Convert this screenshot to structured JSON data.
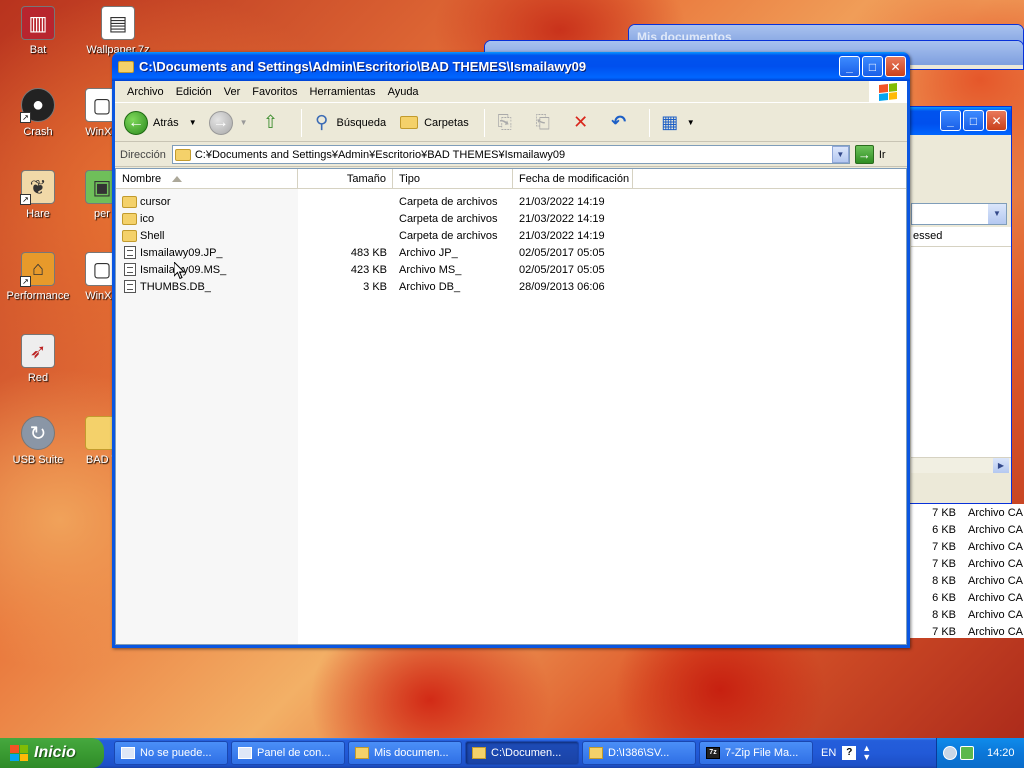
{
  "desktop": {
    "icons": [
      {
        "label": "Bat",
        "icon": "bat-icon"
      },
      {
        "label": "Wallpaper.7z",
        "icon": "archive-icon"
      },
      {
        "label": "Crash",
        "icon": "bomb-icon"
      },
      {
        "label": "WinXP",
        "icon": "window-icon"
      },
      {
        "label": "Hare",
        "icon": "hare-icon"
      },
      {
        "label": "per",
        "icon": "app-icon"
      },
      {
        "label": "Performance",
        "icon": "house-icon"
      },
      {
        "label": "WinXP",
        "icon": "window-icon"
      },
      {
        "label": "Red",
        "icon": "rocket-icon"
      },
      {
        "label": "USB Suite",
        "icon": "usb-icon"
      },
      {
        "label": "BAD T",
        "icon": "folder-icon"
      }
    ],
    "background_windows": {
      "mis_documentos_title": "Mis documentos",
      "partial_column": "essed",
      "partial_rows": [
        {
          "size": "7 KB",
          "type": "Archivo CA"
        },
        {
          "size": "6 KB",
          "type": "Archivo CA"
        },
        {
          "size": "7 KB",
          "type": "Archivo CA"
        },
        {
          "size": "7 KB",
          "type": "Archivo CA"
        },
        {
          "size": "8 KB",
          "type": "Archivo CA"
        },
        {
          "size": "6 KB",
          "type": "Archivo CA"
        },
        {
          "size": "8 KB",
          "type": "Archivo CA"
        },
        {
          "size": "7 KB",
          "type": "Archivo CA"
        }
      ]
    }
  },
  "window": {
    "title": "C:\\Documents and Settings\\Admin\\Escritorio\\BAD THEMES\\Ismailawy09",
    "menu": [
      "Archivo",
      "Edición",
      "Ver",
      "Favoritos",
      "Herramientas",
      "Ayuda"
    ],
    "toolbar": {
      "back_label": "Atrás",
      "search_label": "Búsqueda",
      "folders_label": "Carpetas"
    },
    "address": {
      "label": "Dirección",
      "value": "C:¥Documents and Settings¥Admin¥Escritorio¥BAD THEMES¥Ismailawy09",
      "go_label": "Ir"
    },
    "columns": {
      "name": "Nombre",
      "size": "Tamaño",
      "type": "Tipo",
      "date": "Fecha de modificación"
    },
    "files": [
      {
        "name": "cursor",
        "size": "",
        "type": "Carpeta de archivos",
        "date": "21/03/2022 14:19",
        "kind": "folder"
      },
      {
        "name": "ico",
        "size": "",
        "type": "Carpeta de archivos",
        "date": "21/03/2022 14:19",
        "kind": "folder"
      },
      {
        "name": "Shell",
        "size": "",
        "type": "Carpeta de archivos",
        "date": "21/03/2022 14:19",
        "kind": "folder"
      },
      {
        "name": "Ismailawy09.JP_",
        "size": "483 KB",
        "type": "Archivo JP_",
        "date": "02/05/2017 05:05",
        "kind": "file"
      },
      {
        "name": "Ismailawy09.MS_",
        "size": "423 KB",
        "type": "Archivo MS_",
        "date": "02/05/2017 05:05",
        "kind": "file"
      },
      {
        "name": "THUMBS.DB_",
        "size": "3 KB",
        "type": "Archivo DB_",
        "date": "28/09/2013 06:06",
        "kind": "file"
      }
    ]
  },
  "taskbar": {
    "start_label": "Inicio",
    "tasks": [
      {
        "label": "No se puede...",
        "active": false,
        "icon": "ie"
      },
      {
        "label": "Panel de con...",
        "active": false,
        "icon": "panel"
      },
      {
        "label": "Mis documen...",
        "active": false,
        "icon": "folder"
      },
      {
        "label": "C:\\Documen...",
        "active": true,
        "icon": "folder"
      },
      {
        "label": "D:\\I386\\SV...",
        "active": false,
        "icon": "folder"
      },
      {
        "label": "7-Zip File Ma...",
        "active": false,
        "icon": "zip"
      }
    ],
    "language": "EN",
    "clock": "14:20"
  }
}
